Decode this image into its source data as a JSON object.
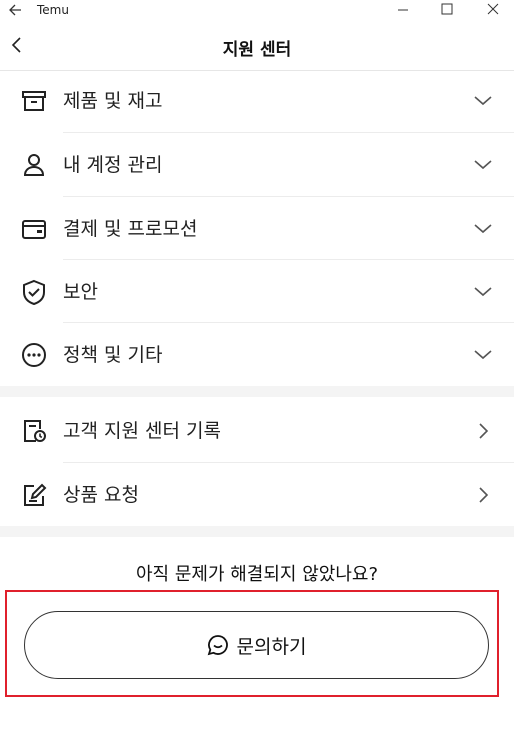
{
  "window": {
    "app_name": "Temu"
  },
  "header": {
    "title": "지원 센터"
  },
  "sections": [
    {
      "items": [
        {
          "label": "제품 및 재고",
          "icon": "box-icon"
        },
        {
          "label": "내 계정 관리",
          "icon": "user-icon"
        },
        {
          "label": "결제 및 프로모션",
          "icon": "wallet-card-icon"
        },
        {
          "label": "보안",
          "icon": "shield-check-icon"
        },
        {
          "label": "정책 및 기타",
          "icon": "more-circle-icon"
        }
      ]
    },
    {
      "items": [
        {
          "label": "고객 지원 센터 기록",
          "icon": "record-history-icon"
        },
        {
          "label": "상품 요청",
          "icon": "edit-request-icon"
        }
      ]
    }
  ],
  "footer": {
    "question": "아직 문제가 해결되지 않았나요?",
    "contact_label": "문의하기"
  },
  "colors": {
    "highlight": "#e0202c"
  }
}
